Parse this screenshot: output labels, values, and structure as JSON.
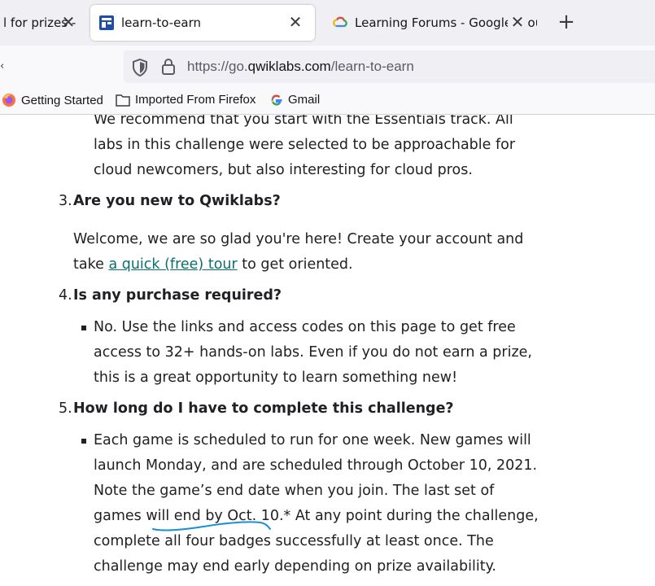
{
  "tabs": [
    {
      "title": "l for prizes -",
      "close": "✕"
    },
    {
      "title": "learn-to-earn",
      "close": "✕"
    },
    {
      "title": "Learning Forums - Google Clouc",
      "close": "✕"
    }
  ],
  "new_tab": "+",
  "nav": {
    "back": "‹",
    "url_prefix": "https://go.",
    "url_domain": "qwiklabs.com",
    "url_path": "/learn-to-earn"
  },
  "bookmarks": [
    {
      "label": "Getting Started"
    },
    {
      "label": "Imported From Firefox"
    },
    {
      "label": "Gmail"
    }
  ],
  "content": {
    "intro_lines": [
      "We recommend that you start with the Essentials track. All",
      "labs in this challenge were selected to be approachable for",
      "cloud newcomers, but also interesting for cloud pros."
    ],
    "q3": {
      "num": "3.",
      "question": "Are you new to Qwiklabs?",
      "line1": "Welcome, we are so glad you're here! Create your account and",
      "line2_pre": "take ",
      "line2_link": "a quick (free) tour",
      "line2_post": " to get oriented."
    },
    "q4": {
      "num": "4.",
      "question": "Is any purchase required?",
      "lines": [
        "No. Use the links and access codes on this page to get free",
        "access to 32+ hands-on labs. Even if you do not earn a prize,",
        "this is a great opportunity to learn something new!"
      ]
    },
    "q5": {
      "num": "5.",
      "question": "How long do I have to complete this challenge?",
      "lines": [
        "Each game is scheduled to run for one week. New games will",
        "launch Monday, and are scheduled through October 10, 2021.",
        "Note the game’s end date when you join. The last set of",
        "games will end by Oct. 10.* At any point during the challenge,",
        "complete all four badges successfully at least once. The",
        "challenge may end early depending on prize availability."
      ]
    }
  },
  "colors": {
    "link": "#0d6e6e",
    "annotation": "#1a8fd6"
  }
}
